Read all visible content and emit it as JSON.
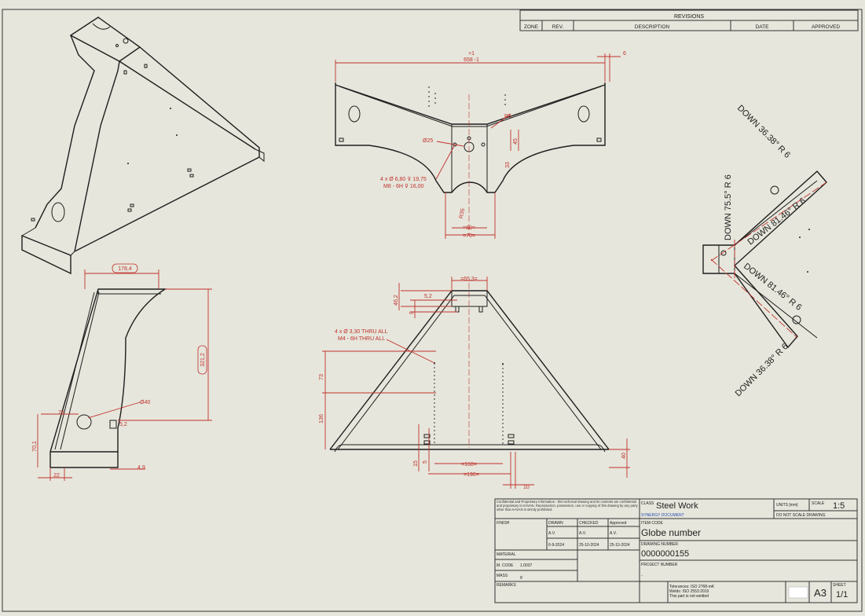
{
  "revisions": {
    "title": "REVISIONS",
    "columns": [
      "ZONE",
      "REV.",
      "DESCRIPTION",
      "DATE",
      "APPROVED"
    ]
  },
  "front_view": {
    "dims": [
      "+1",
      "658 -1",
      "6",
      "R5",
      "Ø25",
      "4 x Ø 6,80 ⊽ 19,75",
      "M8 - 6H ⊽ 16,00",
      "45",
      "33",
      "R35",
      "=60=",
      "=70="
    ]
  },
  "side_view": {
    "dims": [
      "178,4",
      "321,2",
      "Ø40",
      "75",
      "5,2",
      "70,1",
      "22",
      "4,9"
    ]
  },
  "top_view": {
    "dims": [
      "=65,3=",
      "46,2",
      "5,2",
      "9",
      "4 x Ø 3,30 THRU ALL",
      "M4 - 6H THRU ALL",
      "73",
      "136",
      "15",
      "5",
      "=168=",
      "=190=",
      "10",
      "40"
    ]
  },
  "flat_pattern": {
    "bend_notes": [
      "DOWN 36.38° R 6",
      "DOWN 75.5° R 6",
      "DOWN 81.46° R 6",
      "DOWN 81.46° R 6",
      "DOWN 36.38° R 6"
    ]
  },
  "title_block": {
    "confidentiality": "Confidential and Proprietary Information - this technical drawing and its contents are confidential and proprietary to KAVAN. Reproduction, possession, use or copying of this drawing by any party other than KAVAN is strictly prohibited.",
    "class_label": "CLASS",
    "class_value": "Steel Work",
    "synergy": "SYNERGY DOCUMENT",
    "units": "UNITS [mm]",
    "scale_label": "SCALE",
    "scale_value": "1:5",
    "do_not_scale": "DO NOT SCALE DRAWING",
    "finish": "FINISH",
    "drawn": "DRAWN",
    "checked": "CHECKED",
    "approved": "Approved",
    "drawn_by": "A.V.",
    "checked_by": "A.V.",
    "approved_by": "A.V.",
    "drawn_date": "6-9-2024",
    "checked_date": "25-10-2024",
    "approved_date": "25-10-2024",
    "item_code_label": "ITEM CODE",
    "item_code_value": "Globe number",
    "drawing_number_label": "DRAWING NUMBER",
    "drawing_number_value": "0000000155",
    "material_label": "MATERIAL",
    "mcode_label": "M. CODE",
    "mcode_value": "1.0037",
    "mass_label": "MASS",
    "mass_value": "g",
    "project_number_label": "PROJECT NUMBER",
    "project_number_value": "-",
    "remarks_label": "REMARKS",
    "tolerances": "Tolerances: ISO 2768-mK",
    "welds": "Welds: ISO 2553:2019",
    "not_welded": "This part is not welded",
    "size": "A3",
    "sheet_label": "SHEET",
    "sheet_value": "1/1"
  }
}
